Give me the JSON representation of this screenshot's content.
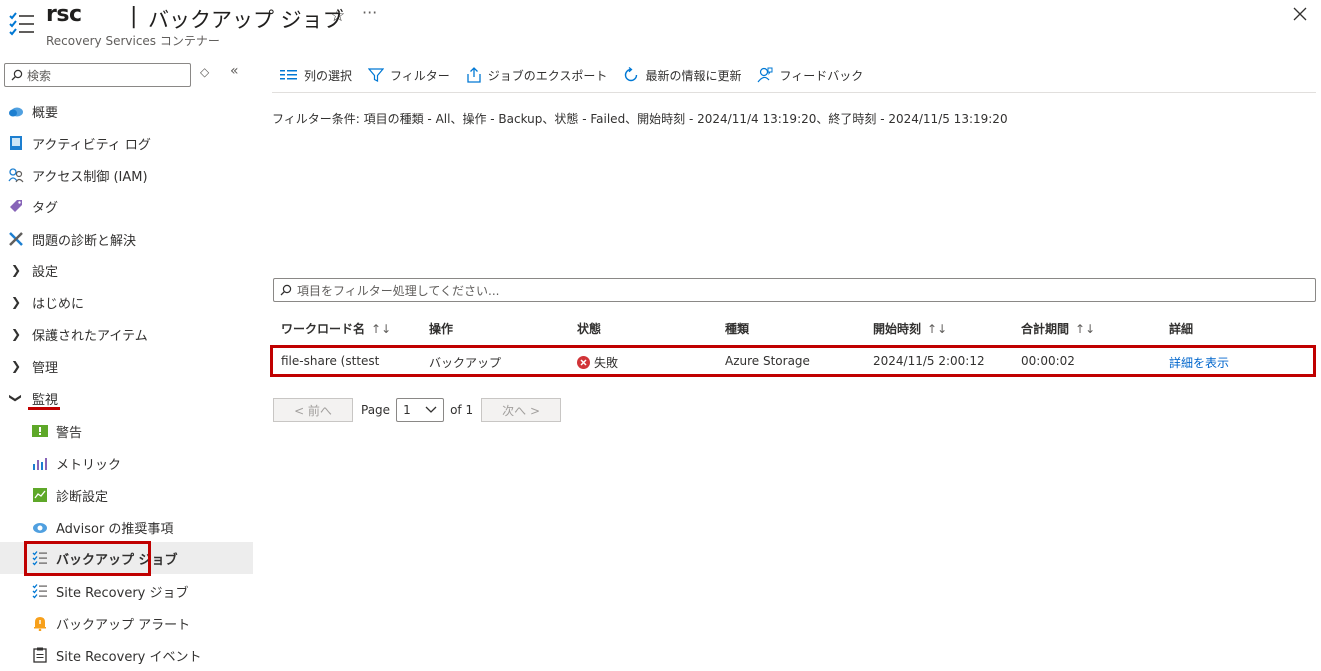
{
  "header": {
    "resource_name": "rsc",
    "separator": "|",
    "page_title": "バックアップ ジョブ",
    "subtitle": "Recovery Services コンテナー",
    "star_glyph": "☆",
    "more_glyph": "···"
  },
  "sidebar": {
    "search_placeholder": "検索",
    "sort_glyph": "◇",
    "collapse_glyph": "«",
    "items": [
      {
        "label": "概要",
        "icon": "cloud-icon"
      },
      {
        "label": "アクティビティ ログ",
        "icon": "log-icon"
      },
      {
        "label": "アクセス制御 (IAM)",
        "icon": "people-icon"
      },
      {
        "label": "タグ",
        "icon": "tag-icon"
      },
      {
        "label": "問題の診断と解決",
        "icon": "wrench-icon"
      },
      {
        "label": "設定",
        "icon": "chevron-right-icon"
      },
      {
        "label": "はじめに",
        "icon": "chevron-right-icon"
      },
      {
        "label": "保護されたアイテム",
        "icon": "chevron-right-icon"
      },
      {
        "label": "管理",
        "icon": "chevron-right-icon"
      },
      {
        "label": "監視",
        "icon": "chevron-down-icon"
      }
    ],
    "sub_items": [
      {
        "label": "警告",
        "icon": "alert-icon"
      },
      {
        "label": "メトリック",
        "icon": "metrics-icon"
      },
      {
        "label": "診断設定",
        "icon": "diagnostic-icon"
      },
      {
        "label": "Advisor の推奨事項",
        "icon": "advisor-icon"
      },
      {
        "label": "バックアップ ジョブ",
        "icon": "job-list-icon"
      },
      {
        "label": "Site Recovery ジョブ",
        "icon": "job-list-icon"
      },
      {
        "label": "バックアップ アラート",
        "icon": "bell-icon"
      },
      {
        "label": "Site Recovery イベント",
        "icon": "clipboard-icon"
      }
    ]
  },
  "toolbar": {
    "columns": "列の選択",
    "filter": "フィルター",
    "export": "ジョブのエクスポート",
    "refresh": "最新の情報に更新",
    "feedback": "フィードバック"
  },
  "filter_description": "フィルター条件: 項目の種類 - All、操作 - Backup、状態 - Failed、開始時刻 - 2024/11/4 13:19:20、終了時刻 - 2024/11/5 13:19:20",
  "grid": {
    "filter_placeholder": "項目をフィルター処理してください...",
    "columns": [
      "ワークロード名",
      "操作",
      "状態",
      "種類",
      "開始時刻",
      "合計期間",
      "詳細"
    ],
    "sort_glyph": "↑↓",
    "rows": [
      {
        "workload": "file-share (sttest",
        "operation": "バックアップ",
        "status": "失敗",
        "type": "Azure Storage",
        "start": "2024/11/5 2:00:12",
        "duration": "00:00:02",
        "details": "詳細を表示"
      }
    ]
  },
  "pager": {
    "prev": "< 前へ",
    "page_label": "Page",
    "page_value": "1",
    "of_label": "of 1",
    "next": "次へ >"
  },
  "colors": {
    "highlight": "#c00000",
    "link": "#0066cc",
    "error": "#d13438",
    "accent": "#0078d4"
  }
}
